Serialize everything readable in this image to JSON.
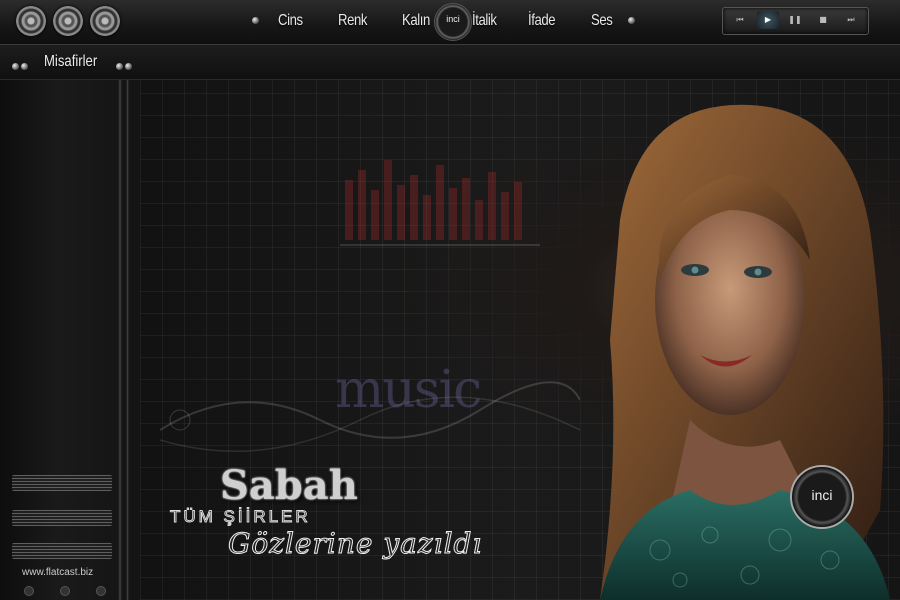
{
  "menu": {
    "items": [
      "Cins",
      "Renk",
      "Kalın",
      "İtalik",
      "İfade",
      "Ses"
    ],
    "logo_text": "inci"
  },
  "player": {
    "buttons": [
      "prev-icon",
      "play-icon",
      "pause-icon",
      "stop-icon",
      "next-icon"
    ]
  },
  "subbar": {
    "guests_label": "Misafirler"
  },
  "sidebar": {
    "site_text": "www.flatcast.biz"
  },
  "stage": {
    "music_watermark": "music",
    "title_main": "Sabah",
    "title_sub": "TÜM ŞİİRLER",
    "title_script": "Gözlerine yazıldı",
    "logo_text": "inci"
  },
  "colors": {
    "background": "#0b0b0b",
    "bar": "#1a1a1a",
    "dress": "#1f5a52",
    "hair": "#8a5a2e"
  }
}
